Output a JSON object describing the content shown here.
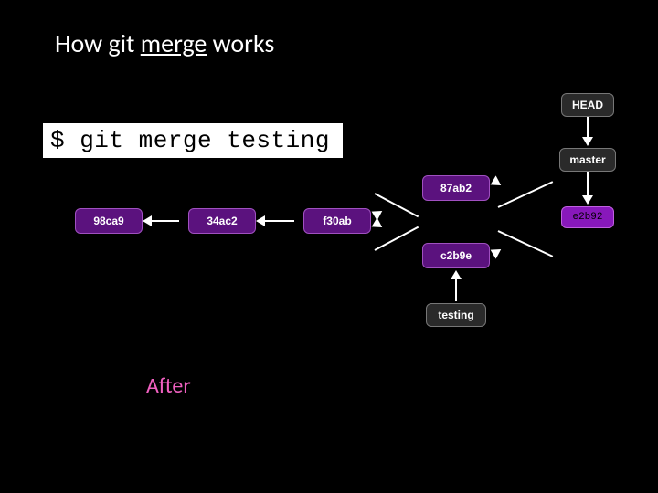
{
  "title": {
    "prefix": "How git ",
    "emph": "merge",
    "suffix": " works"
  },
  "command": "$ git merge testing",
  "after_label": "After",
  "nodes": {
    "c1": "98ca9",
    "c2": "34ac2",
    "c3": "f30ab",
    "c4": "87ab2",
    "c5": "c2b9e",
    "merge": "e2b92",
    "head": "HEAD",
    "master": "master",
    "testing": "testing"
  },
  "colors": {
    "purple_fill": "#5b127e",
    "gray_fill": "#2a2a2a",
    "merge_fill": "#8818bb",
    "accent_text": "#f060c0"
  }
}
